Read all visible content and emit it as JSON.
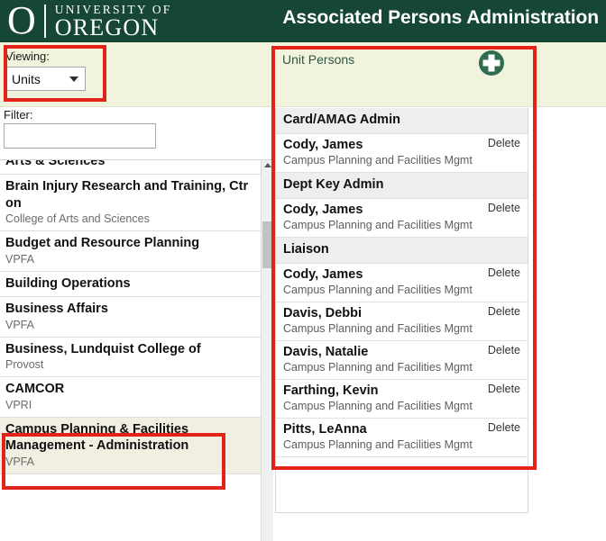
{
  "header": {
    "logo_letter": "O",
    "logo_line1": "UNIVERSITY OF",
    "logo_line2": "OREGON",
    "app_title": "Associated Persons Administration",
    "bg_color": "#154734"
  },
  "left_pane": {
    "viewing_label": "Viewing:",
    "viewing_value": "Units",
    "viewing_options": [
      "Units"
    ],
    "filter_label": "Filter:",
    "filter_value": "",
    "units": [
      {
        "name": "Arts & Sciences",
        "sub": "",
        "selected": false,
        "clipped": true
      },
      {
        "name": "Brain Injury Research and Training, Ctr on",
        "sub": "College of Arts and Sciences",
        "selected": false,
        "clipped": false
      },
      {
        "name": "Budget and Resource Planning",
        "sub": "VPFA",
        "selected": false,
        "clipped": false
      },
      {
        "name": "Building Operations",
        "sub": "",
        "selected": false,
        "clipped": false
      },
      {
        "name": "Business Affairs",
        "sub": "VPFA",
        "selected": false,
        "clipped": false
      },
      {
        "name": "Business, Lundquist College of",
        "sub": "Provost",
        "selected": false,
        "clipped": false
      },
      {
        "name": "CAMCOR",
        "sub": "VPRI",
        "selected": false,
        "clipped": false
      },
      {
        "name": "Campus Planning & Facilities Management - Administration",
        "sub": "VPFA",
        "selected": true,
        "clipped": false
      }
    ]
  },
  "right_pane": {
    "title": "Unit Persons",
    "add_icon": "plus-circle-icon",
    "add_icon_color": "#2e6b4f",
    "delete_label": "Delete",
    "groups": [
      {
        "role": "Card/AMAG Admin",
        "people": [
          {
            "name": "Cody, James",
            "unit": "Campus Planning and Facilities Mgmt"
          }
        ]
      },
      {
        "role": "Dept Key Admin",
        "people": [
          {
            "name": "Cody, James",
            "unit": "Campus Planning and Facilities Mgmt"
          }
        ]
      },
      {
        "role": "Liaison",
        "people": [
          {
            "name": "Cody, James",
            "unit": "Campus Planning and Facilities Mgmt"
          },
          {
            "name": "Davis, Debbi",
            "unit": "Campus Planning and Facilities Mgmt"
          },
          {
            "name": "Davis, Natalie",
            "unit": "Campus Planning and Facilities Mgmt"
          },
          {
            "name": "Farthing, Kevin",
            "unit": "Campus Planning and Facilities Mgmt"
          },
          {
            "name": "Pitts, LeAnna",
            "unit": "Campus Planning and Facilities Mgmt"
          }
        ]
      }
    ]
  },
  "annotations": {
    "highlight_color": "#e2231a",
    "boxes": [
      "viewing-dropdown",
      "selected-unit-row",
      "unit-persons-panel"
    ]
  }
}
